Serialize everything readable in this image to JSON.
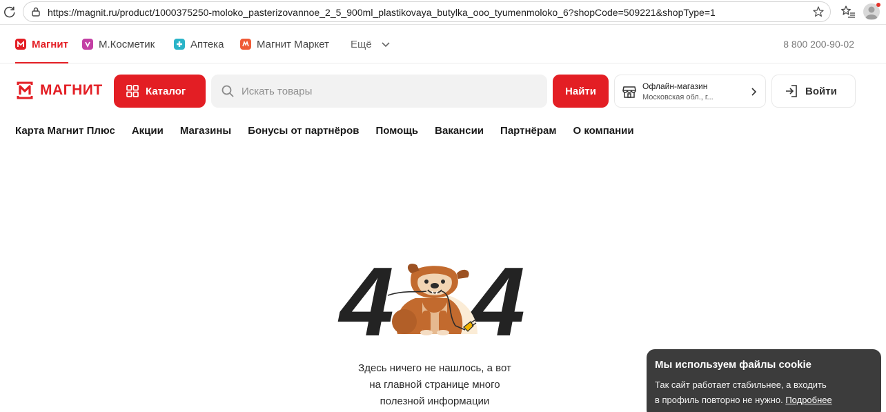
{
  "browser": {
    "url": "https://magnit.ru/product/1000375250-moloko_pasterizovannoe_2_5_900ml_plastikovaya_butylka_ooo_tyumenmoloko_6?shopCode=509221&shopType=1"
  },
  "services": {
    "items": [
      {
        "label": "Магнит",
        "icon": "magnit-icon",
        "color": "#e31e24"
      },
      {
        "label": "М.Косметик",
        "icon": "kosmetik-icon",
        "color": "#c33fa4"
      },
      {
        "label": "Аптека",
        "icon": "apteka-icon",
        "color": "#2ab4c8"
      },
      {
        "label": "Магнит Маркет",
        "icon": "market-icon",
        "color": "#ef5a36"
      },
      {
        "label": "Ещё",
        "icon": "chevron-down-icon"
      }
    ],
    "phone": "8 800 200-90-02"
  },
  "header": {
    "logo_text": "МАГНИТ",
    "catalog_label": "Каталог",
    "search_placeholder": "Искать товары",
    "find_label": "Найти",
    "store_title": "Офлайн-магазин",
    "store_address": "Московская обл., г...",
    "login_label": "Войти"
  },
  "nav": {
    "items": [
      "Карта Магнит Плюс",
      "Акции",
      "Магазины",
      "Бонусы от партнёров",
      "Помощь",
      "Вакансии",
      "Партнёрам",
      "О компании"
    ]
  },
  "error": {
    "digit_left": "4",
    "digit_right": "4",
    "message_line1": "Здесь ничего не нашлось, а вот",
    "message_line2": "на главной странице много",
    "message_line3": "полезной информации"
  },
  "cookie": {
    "title": "Мы используем файлы cookie",
    "text_line1": "Так сайт работает стабильнее, а входить",
    "text_line2": "в профиль повторно не нужно.",
    "link": "Подробнее"
  },
  "colors": {
    "brand_red": "#e31e24",
    "cookie_bg": "#3c3c3c"
  }
}
